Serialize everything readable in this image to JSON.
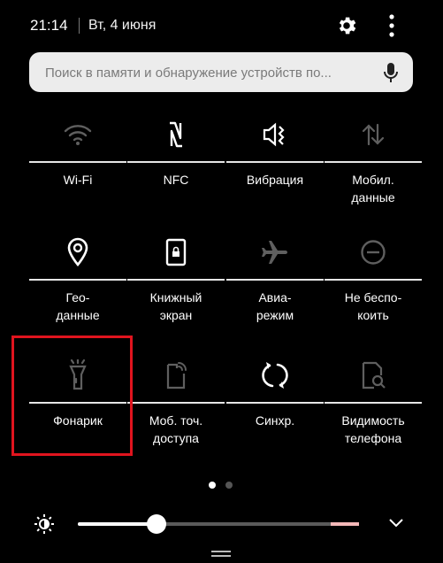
{
  "status_bar": {
    "time": "21:14",
    "date": "Вт, 4 июня"
  },
  "search": {
    "placeholder": "Поиск в памяти и обнаружение устройств по..."
  },
  "tiles": [
    {
      "label": "Wi-Fi",
      "icon": "wifi-icon",
      "active": false
    },
    {
      "label": "NFC",
      "icon": "nfc-icon",
      "active": true
    },
    {
      "label": "Вибрация",
      "icon": "vibration-icon",
      "active": true
    },
    {
      "label": "Мобил.\nданные",
      "icon": "mobile-data-icon",
      "active": false
    },
    {
      "label": "Гео-\nданные",
      "icon": "location-icon",
      "active": true
    },
    {
      "label": "Книжный\nэкран",
      "icon": "portrait-lock-icon",
      "active": true
    },
    {
      "label": "Авиа-\nрежим",
      "icon": "airplane-icon",
      "active": false
    },
    {
      "label": "Не беспо-\nкоить",
      "icon": "do-not-disturb-icon",
      "active": false
    },
    {
      "label": "Фонарик",
      "icon": "flashlight-icon",
      "active": false
    },
    {
      "label": "Моб. точ.\nдоступа",
      "icon": "hotspot-icon",
      "active": false
    },
    {
      "label": "Синхр.",
      "icon": "sync-icon",
      "active": true
    },
    {
      "label": "Видимость\nтелефона",
      "icon": "visibility-icon",
      "active": false
    }
  ],
  "pagination": {
    "pages": 2,
    "current": 1
  },
  "brightness": {
    "level": 0.28
  },
  "colors": {
    "background": "#000000",
    "highlight": "#e0141e",
    "active_icon": "#ffffff",
    "inactive_icon": "#5f5f5f"
  }
}
